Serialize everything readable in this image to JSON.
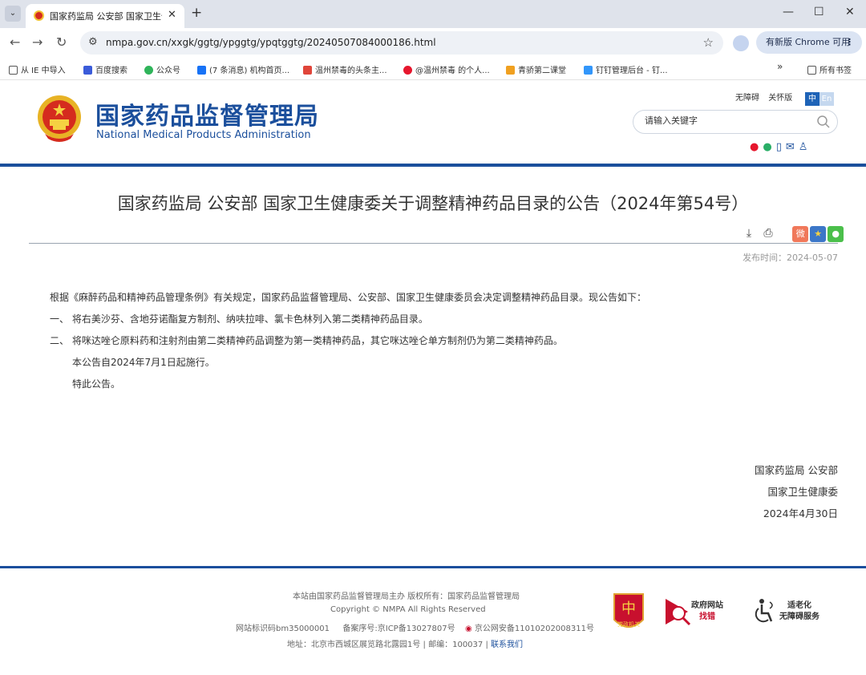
{
  "browser": {
    "tab_title": "国家药监局 公安部 国家卫生健...",
    "url": "nmpa.gov.cn/xxgk/ggtg/ypggtg/ypqtggtg/20240507084000186.html",
    "update_label": "有新版 Chrome 可用",
    "bookmarks": [
      "从 IE 中导入",
      "百度搜索",
      "公众号",
      "(7 条消息) 机构首页...",
      "温州禁毒的头条主...",
      "@温州禁毒 的个人...",
      "青骄第二课堂",
      "钉钉管理后台 - 钉...",
      "所有书签"
    ]
  },
  "header": {
    "logo_cn": "国家药品监督管理局",
    "logo_en": "National Medical Products Administration",
    "links": [
      "无障碍",
      "关怀版"
    ],
    "lang_zh": "中",
    "lang_en": "En",
    "search_placeholder": "请输入关键字"
  },
  "article": {
    "title": "国家药监局 公安部 国家卫生健康委关于调整精神药品目录的公告（2024年第54号）",
    "publish_date": "发布时间：2024-05-07",
    "paragraphs": [
      "根据《麻醉药品和精神药品管理条例》有关规定，国家药品监督管理局、公安部、国家卫生健康委员会决定调整精神药品目录。现公告如下：",
      "一、  将右美沙芬、含地芬诺酯复方制剂、纳呋拉啡、氯卡色林列入第二类精神药品目录。",
      "二、  将咪达唑仑原料药和注射剂由第二类精神药品调整为第一类精神药品，其它咪达唑仑单方制剂仍为第二类精神药品。",
      "本公告自2024年7月1日起施行。",
      "特此公告。"
    ],
    "signature": [
      "国家药监局 公安部",
      "国家卫生健康委",
      "2024年4月30日"
    ]
  },
  "footer": {
    "line1": "本站由国家药品监督管理局主办 版权所有：国家药品监督管理局",
    "line2": "Copyright © NMPA All Rights Reserved",
    "site_id": "网站标识码bm35000001",
    "icp": "备案序号:京ICP备13027807号",
    "police": "京公网安备11010202008311号",
    "address": "地址：北京市西城区展览路北露园1号 | 邮编：100037 |",
    "contact": "联系我们",
    "badge_party": "党政机关",
    "badge_gov_1": "政府网站",
    "badge_gov_2": "找错",
    "badge_access_1": "适老化",
    "badge_access_2": "无障碍服务"
  }
}
